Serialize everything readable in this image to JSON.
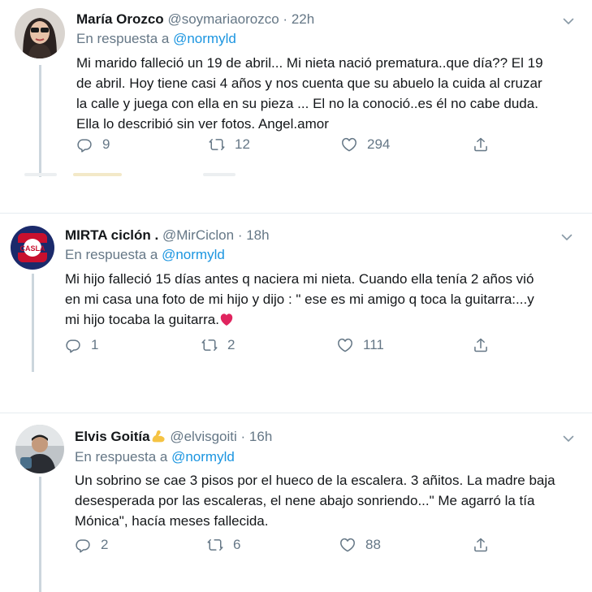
{
  "tweets": [
    {
      "name": "María Orozco",
      "handle": "@soymariaorozco",
      "separator": "·",
      "time": "22h",
      "reply_prefix": "En respuesta a",
      "reply_to": "@normyld",
      "lines": [
        "Mi marido falleció un 19 de abril... Mi nieta nació prematura..que día?? El 19",
        "de abril. Hoy tiene casi 4 años y nos cuenta que su abuelo la cuida al cruzar",
        "la calle y juega con ella en su pieza ... El no la conoció..es él no cabe duda.",
        "Ella lo describió sin ver fotos. Angel.amor"
      ],
      "replies": "9",
      "retweets": "12",
      "likes": "294"
    },
    {
      "name": "MIRTA ciclón .",
      "handle": "@MirCiclon",
      "separator": "·",
      "time": "18h",
      "reply_prefix": "En respuesta a",
      "reply_to": "@normyld",
      "lines": [
        "Mi hijo falleció 15 días antes q naciera mi nieta. Cuando ella tenía 2 años vió",
        "en mi casa una foto de mi hijo y dijo : \" ese es mi amigo q toca la guitarra:...y",
        "mi hijo tocaba la guitarra."
      ],
      "replies": "1",
      "retweets": "2",
      "likes": "111"
    },
    {
      "name": "Elvis Goitía",
      "handle": "@elvisgoiti",
      "separator": "·",
      "time": "16h",
      "reply_prefix": "En respuesta a",
      "reply_to": "@normyld",
      "lines": [
        "Un sobrino se cae 3 pisos por el hueco de la escalera. 3 añitos. La madre baja",
        "desesperada por las escaleras, el nene abajo sonriendo...\" Me agarró la tía",
        "Mónica\", hacía meses fallecida."
      ],
      "replies": "2",
      "retweets": "6",
      "likes": "88"
    }
  ],
  "icons": {
    "reply": "reply-icon",
    "retweet": "retweet-icon",
    "like": "heart-icon",
    "share": "share-icon",
    "menu": "chevron-down-icon",
    "emoji_heart": "red-heart-emoji",
    "emoji_flex": "flexed-biceps-emoji"
  },
  "colors": {
    "text": "#14171a",
    "secondary": "#657786",
    "link": "#1b95e0",
    "divider": "#e6ecf0",
    "thread": "#ccd6dd",
    "emoji_heart": "#e0245e"
  }
}
